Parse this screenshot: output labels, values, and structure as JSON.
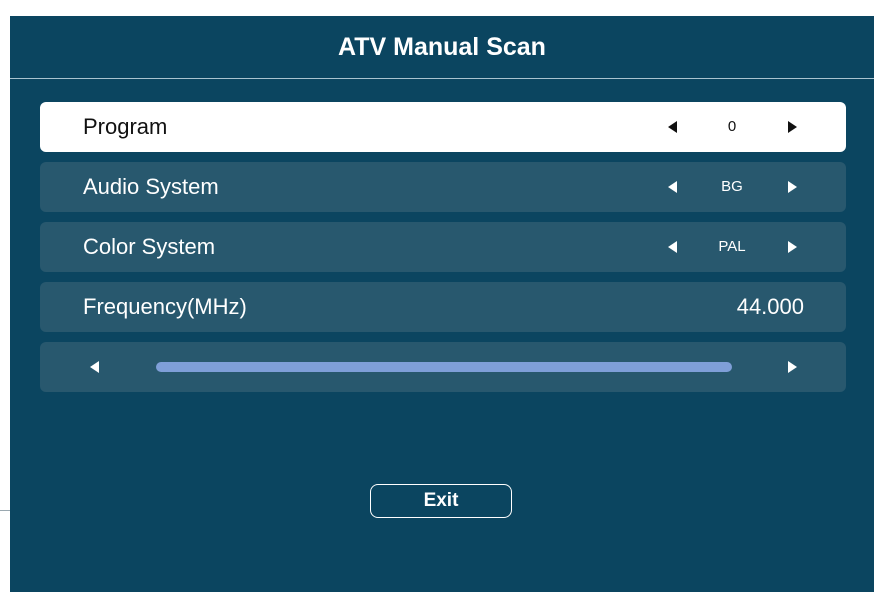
{
  "header": {
    "title": "ATV Manual Scan"
  },
  "rows": [
    {
      "label": "Program",
      "value": "0"
    },
    {
      "label": "Audio System",
      "value": "BG"
    },
    {
      "label": "Color System",
      "value": "PAL"
    },
    {
      "label": "Frequency(MHz)",
      "value": "44.000"
    }
  ],
  "slider": {
    "level": 1.0
  },
  "footer": {
    "exit_label": "Exit"
  },
  "colors": {
    "background": "#0b4560",
    "row": "#28586e",
    "selected_row": "#ffffff",
    "slider_fill": "#7f9fd8"
  }
}
